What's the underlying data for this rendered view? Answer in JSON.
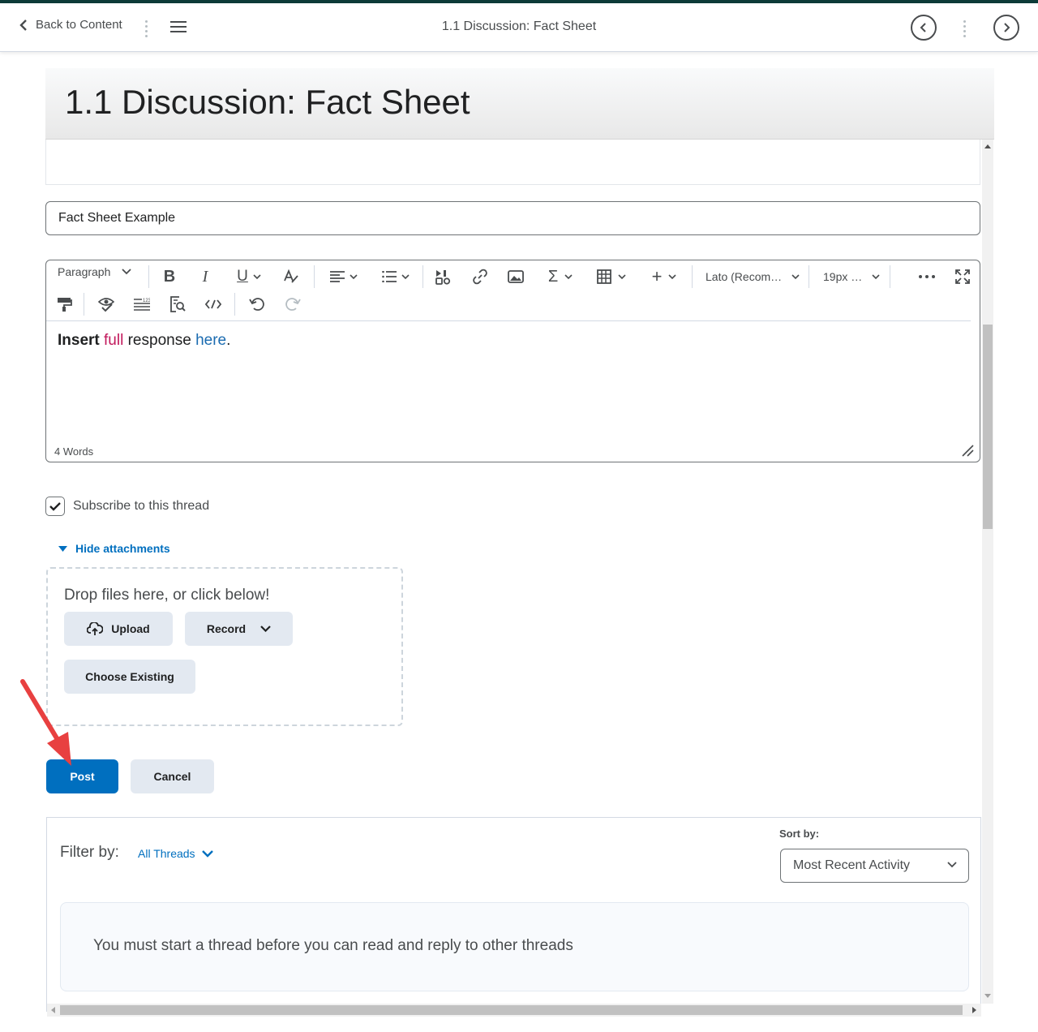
{
  "nav": {
    "back_label": "Back to Content",
    "title": "1.1 Discussion: Fact Sheet"
  },
  "page": {
    "heading": "1.1 Discussion: Fact Sheet"
  },
  "form": {
    "subject_value": "Fact Sheet Example",
    "editor": {
      "paragraph_label": "Paragraph",
      "font_label": "Lato (Recom…",
      "size_label": "19px …",
      "text_bold": "Insert",
      "text_colored": "full",
      "text_plain": " response ",
      "text_link": "here",
      "text_end": ".",
      "word_count": "4 Words",
      "colors": {
        "bold": "#202122",
        "colored": "#c2185b",
        "link": "#1a6bb0"
      }
    },
    "subscribe_label": "Subscribe to this thread",
    "subscribe_checked": true,
    "hide_attachments_label": "Hide attachments",
    "drop_text": "Drop files here, or click below!",
    "upload_label": "Upload",
    "record_label": "Record",
    "choose_existing_label": "Choose Existing",
    "post_label": "Post",
    "cancel_label": "Cancel"
  },
  "filter": {
    "filter_by_label": "Filter by:",
    "filter_value": "All Threads",
    "sort_by_label": "Sort by:",
    "sort_value": "Most Recent Activity",
    "message": "You must start a thread before you can read and reply to other threads"
  },
  "colors": {
    "accent": "#006fbf",
    "annotation_arrow": "#e84040",
    "topline": "#0d3b38"
  }
}
